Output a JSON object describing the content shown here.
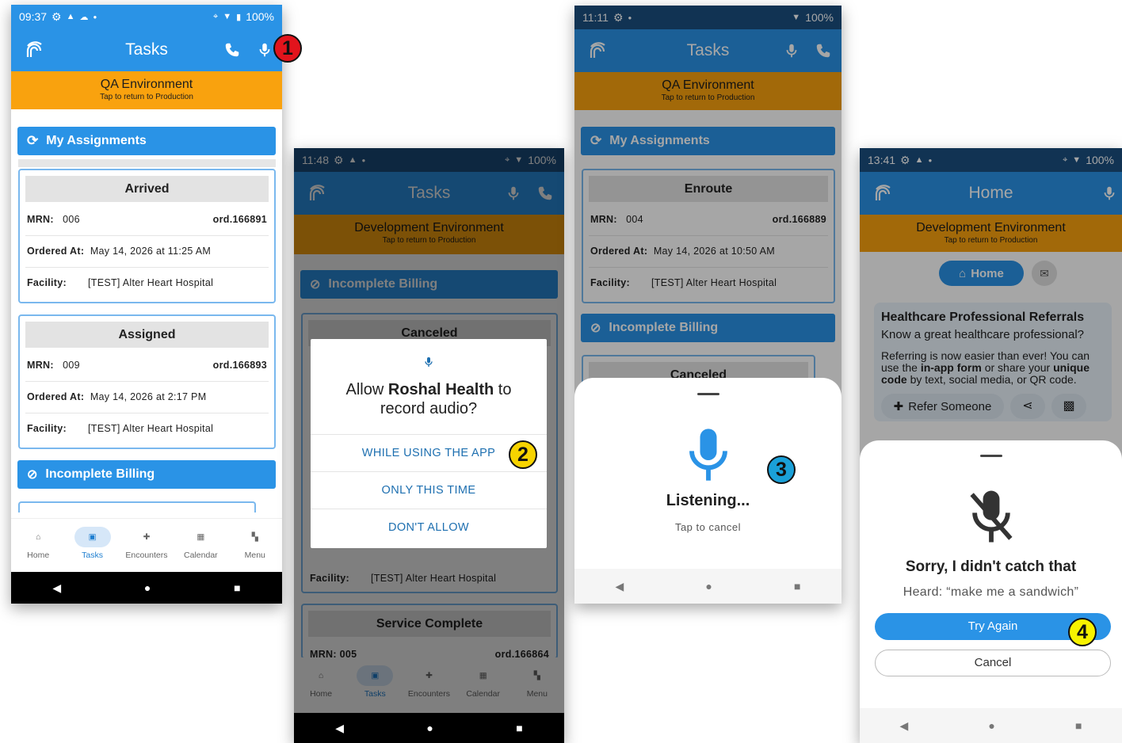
{
  "colors": {
    "primary": "#2a93e6",
    "env_bar": "#f9a20e",
    "card_border": "#7ab8ee"
  },
  "screen1": {
    "status": {
      "time": "09:37",
      "battery": "100%"
    },
    "app_title": "Tasks",
    "env": {
      "name": "QA Environment",
      "sub": "Tap to return to Production"
    },
    "section_assignments": "My Assignments",
    "section_billing": "Incomplete Billing",
    "labels": {
      "mrn": "MRN:",
      "ordered_at": "Ordered At:",
      "facility": "Facility:"
    },
    "cards": [
      {
        "status": "Arrived",
        "mrn": "006",
        "order": "ord.166891",
        "ordered_at": "May 14, 2026 at 11:25 AM",
        "facility": "[TEST] Alter Heart Hospital"
      },
      {
        "status": "Assigned",
        "mrn": "009",
        "order": "ord.166893",
        "ordered_at": "May 14, 2026 at 2:17 PM",
        "facility": "[TEST] Alter Heart Hospital"
      }
    ],
    "nav": [
      "Home",
      "Tasks",
      "Encounters",
      "Calendar",
      "Menu"
    ]
  },
  "screen2": {
    "status": {
      "time": "11:48",
      "battery": "100%"
    },
    "app_title": "Tasks",
    "env": {
      "name": "Development Environment",
      "sub": "Tap to return to Production"
    },
    "section_billing": "Incomplete Billing",
    "card1_status": "Canceled",
    "facility_label": "Facility:",
    "facility_value": "[TEST] Alter Heart Hospital",
    "card2_status": "Service Complete",
    "card2_mrn": "MRN:  005",
    "card2_order": "ord.166864",
    "dialog": {
      "title": "Allow Roshal Health to record audio?",
      "title_bold": "Roshal Health",
      "title_pre": "Allow",
      "title_post": "to record audio?",
      "options": [
        "WHILE USING THE APP",
        "ONLY THIS TIME",
        "DON'T ALLOW"
      ]
    },
    "nav": [
      "Home",
      "Tasks",
      "Encounters",
      "Calendar",
      "Menu"
    ]
  },
  "screen3": {
    "status": {
      "time": "11:11",
      "battery": "100%"
    },
    "app_title": "Tasks",
    "env": {
      "name": "QA Environment",
      "sub": "Tap to return to Production"
    },
    "section_assignments": "My Assignments",
    "card": {
      "status": "Enroute",
      "mrn": "004",
      "order": "ord.166889",
      "ordered_at": "May 14, 2026 at 10:50 AM",
      "facility": "[TEST] Alter Heart Hospital"
    },
    "labels": {
      "mrn": "MRN:",
      "ordered_at": "Ordered At:",
      "facility": "Facility:"
    },
    "section_billing": "Incomplete Billing",
    "card2_status": "Canceled",
    "sheet": {
      "title": "Listening...",
      "sub": "Tap to cancel"
    }
  },
  "screen4": {
    "status": {
      "time": "13:41",
      "battery": "100%"
    },
    "app_title": "Home",
    "env": {
      "name": "Development Environment",
      "sub": "Tap to return to Production"
    },
    "home_chip": "Home",
    "referral": {
      "title": "Healthcare Professional Referrals",
      "subtitle": "Know a great healthcare professional?",
      "p1": "Referring is now easier than ever! You can use the ",
      "b1": "in-app form",
      "p2": " or share your ",
      "b2": "unique code",
      "p3": " by text, social media, or QR code.",
      "refer_button": "Refer Someone"
    },
    "sheet": {
      "title": "Sorry, I didn't catch that",
      "heard": "Heard: “make me a sandwich”",
      "try_again": "Try Again",
      "cancel": "Cancel"
    }
  },
  "badges": [
    "1",
    "2",
    "3",
    "4"
  ]
}
